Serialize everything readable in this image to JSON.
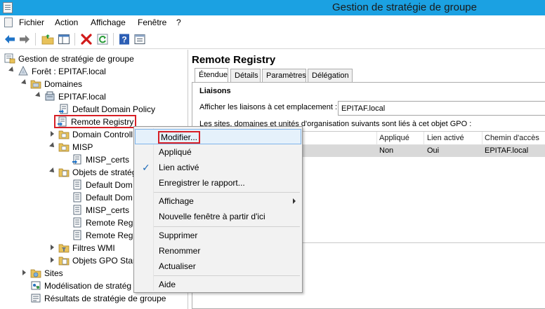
{
  "window": {
    "title": "Gestion de stratégie de groupe"
  },
  "menu": {
    "items": [
      "Fichier",
      "Action",
      "Affichage",
      "Fenêtre",
      "?"
    ]
  },
  "toolbar": {
    "icons": [
      "back-arrow-icon",
      "forward-arrow-icon",
      "folder-up-icon",
      "show-hide-tree-icon",
      "delete-icon",
      "refresh-icon",
      "help-icon",
      "properties-icon"
    ],
    "colors": {
      "back": "#1e73c7",
      "delete": "#d11a1a",
      "refresh": "#2a9d3a",
      "help": "#2d5fb5"
    }
  },
  "tree": {
    "root": "Gestion de stratégie de groupe",
    "forest": "Forêt : EPITAF.local",
    "domains": "Domaines",
    "domain": "EPITAF.local",
    "default_domain_policy": "Default Domain Policy",
    "remote_registry": "Remote Registry",
    "domain_controllers": "Domain Controll",
    "misp": "MISP",
    "misp_certs": "MISP_certs",
    "gpo_objects": "Objets de stratég",
    "gpo_items": [
      "Default Dom",
      "Default Dom",
      "MISP_certs",
      "Remote Regi",
      "Remote Regi"
    ],
    "wmi_filters": "Filtres WMI",
    "starter_gpos": "Objets GPO Start",
    "sites": "Sites",
    "modeling": "Modélisation de stratég",
    "results": "Résultats de stratégie de groupe"
  },
  "details": {
    "title": "Remote Registry",
    "tabs": [
      "Étendue",
      "Détails",
      "Paramètres",
      "Délégation"
    ],
    "active_tab": "Étendue",
    "links_heading": "Liaisons",
    "location_label": "Afficher les liaisons à cet emplacement :",
    "location_value": "EPITAF.local",
    "linked_text": "Les sites, domaines et unités d'organisation suivants sont liés à cet objet GPO :",
    "columns": [
      "Appliqué",
      "Lien activé",
      "Chemin d'accès"
    ],
    "row": {
      "applied": "Non",
      "link_enabled": "Oui",
      "path": "EPITAF.local"
    }
  },
  "context_menu": {
    "items": [
      {
        "label": "Modifier...",
        "hover": true
      },
      {
        "label": "Appliqué"
      },
      {
        "label": "Lien activé",
        "checked": true
      },
      {
        "label": "Enregistrer le rapport..."
      },
      {
        "label": "Affichage",
        "submenu": true
      },
      {
        "label": "Nouvelle fenêtre à partir d'ici"
      },
      {
        "label": "Supprimer"
      },
      {
        "label": "Renommer"
      },
      {
        "label": "Actualiser"
      },
      {
        "label": "Aide"
      }
    ]
  }
}
